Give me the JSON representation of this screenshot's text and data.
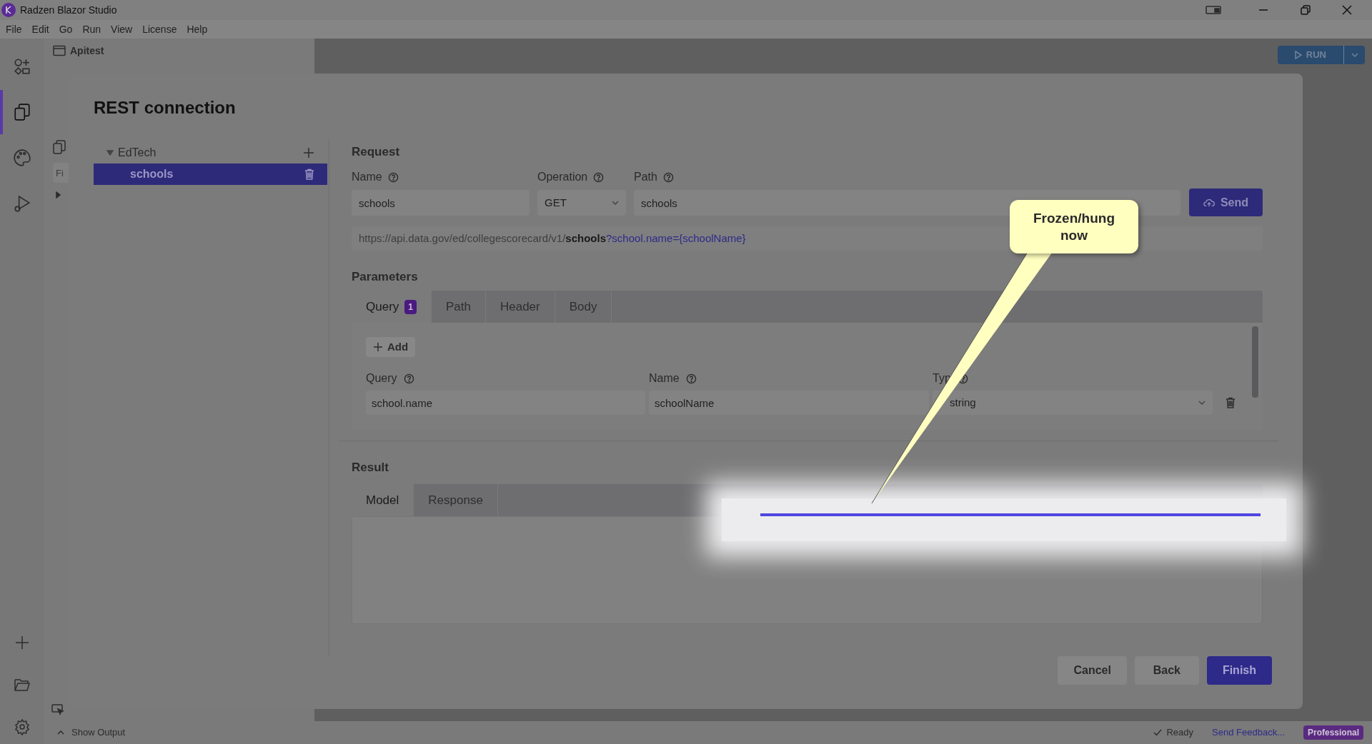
{
  "window": {
    "title": "Radzen Blazor Studio"
  },
  "menu": [
    "File",
    "Edit",
    "Go",
    "Run",
    "View",
    "License",
    "Help"
  ],
  "activity_bar": [
    {
      "selected": false
    },
    {
      "selected": true
    },
    {
      "selected": false
    },
    {
      "selected": false
    }
  ],
  "explorer": {
    "title": "Apitest",
    "filter_placeholder": "Fi"
  },
  "toolbar": {
    "run_label": "RUN"
  },
  "dialog": {
    "title": "REST connection",
    "tree": [
      {
        "label": "EdTech",
        "expanded": true,
        "children": [
          {
            "label": "schools",
            "selected": true
          }
        ]
      }
    ],
    "request": {
      "heading": "Request",
      "fields": [
        {
          "label": "Name",
          "value": "schools",
          "kind": "text"
        },
        {
          "label": "Operation",
          "value": "GET",
          "kind": "select"
        },
        {
          "label": "Path",
          "value": "schools",
          "kind": "text"
        }
      ],
      "send_label": "Send",
      "url_base": "https://api.data.gov/ed/collegescorecard/v1/",
      "url_path": "schools",
      "url_query": "?school.name={schoolName}"
    },
    "parameters": {
      "heading": "Parameters",
      "tabs": [
        {
          "label": "Query",
          "badge": "1",
          "selected": true
        },
        {
          "label": "Path",
          "selected": false
        },
        {
          "label": "Header",
          "selected": false
        },
        {
          "label": "Body",
          "selected": false
        }
      ],
      "add_label": "Add",
      "columns": [
        "Query",
        "Name",
        "Typ"
      ],
      "rows": [
        {
          "query": "school.name",
          "name": "schoolName",
          "type": "string"
        }
      ]
    },
    "result": {
      "heading": "Result",
      "tabs": [
        {
          "label": "Model",
          "selected": true
        },
        {
          "label": "Response",
          "selected": false
        }
      ]
    },
    "buttons": [
      {
        "label": "Cancel",
        "kind": "secondary"
      },
      {
        "label": "Back",
        "kind": "secondary"
      },
      {
        "label": "Finish",
        "kind": "primary"
      }
    ]
  },
  "annotation": {
    "text": "Frozen/hung now"
  },
  "status_bar": {
    "output_label": "Show Output",
    "status": "Ready",
    "feedback": "Send Feedback...",
    "license": "Professional"
  }
}
